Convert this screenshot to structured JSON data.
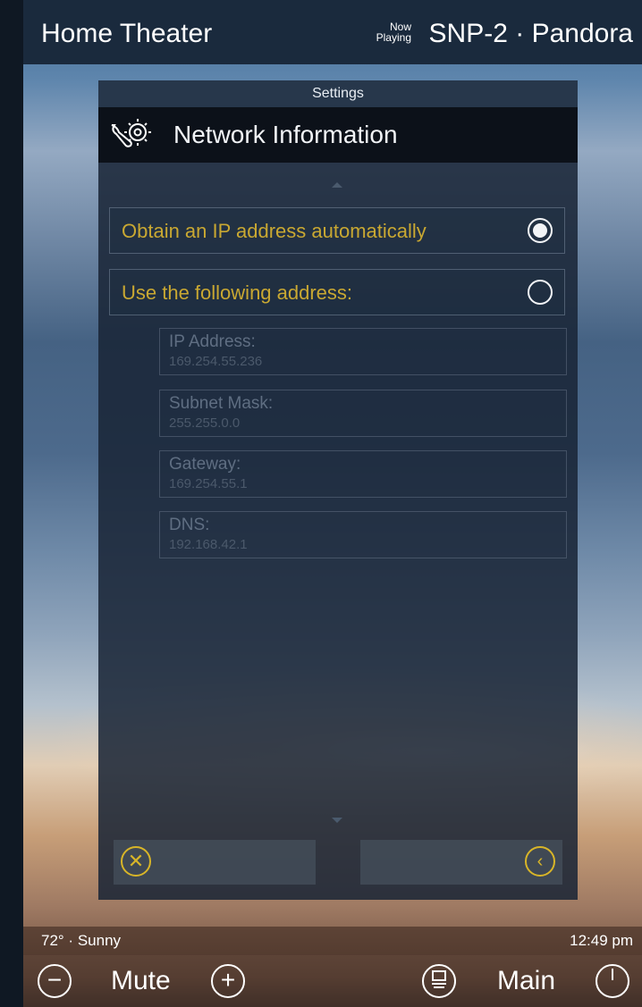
{
  "header": {
    "room": "Home Theater",
    "now_playing_label_1": "Now",
    "now_playing_label_2": "Playing",
    "source": "SNP-2 · Pandora"
  },
  "panel": {
    "section": "Settings",
    "title": "Network Information",
    "options": [
      {
        "label": "Obtain an IP address automatically",
        "selected": true
      },
      {
        "label": "Use the following address:",
        "selected": false
      }
    ],
    "fields": [
      {
        "label": "IP Address:",
        "value": "169.254.55.236"
      },
      {
        "label": "Subnet Mask:",
        "value": "255.255.0.0"
      },
      {
        "label": "Gateway:",
        "value": "169.254.55.1"
      },
      {
        "label": "DNS:",
        "value": "192.168.42.1"
      }
    ],
    "cancel_icon": "x-circle-icon",
    "back_icon": "chevron-left-circle-icon"
  },
  "status": {
    "weather": "72° · Sunny",
    "time": "12:49 pm"
  },
  "controls": {
    "mute": "Mute",
    "main": "Main",
    "vol_down_icon": "minus-circle-icon",
    "vol_up_icon": "plus-circle-icon",
    "menu_icon": "menu-circle-icon",
    "power_icon": "power-icon"
  },
  "colors": {
    "accent": "#c9a832",
    "topbar": "#1a2a3d",
    "panel": "#182436"
  }
}
